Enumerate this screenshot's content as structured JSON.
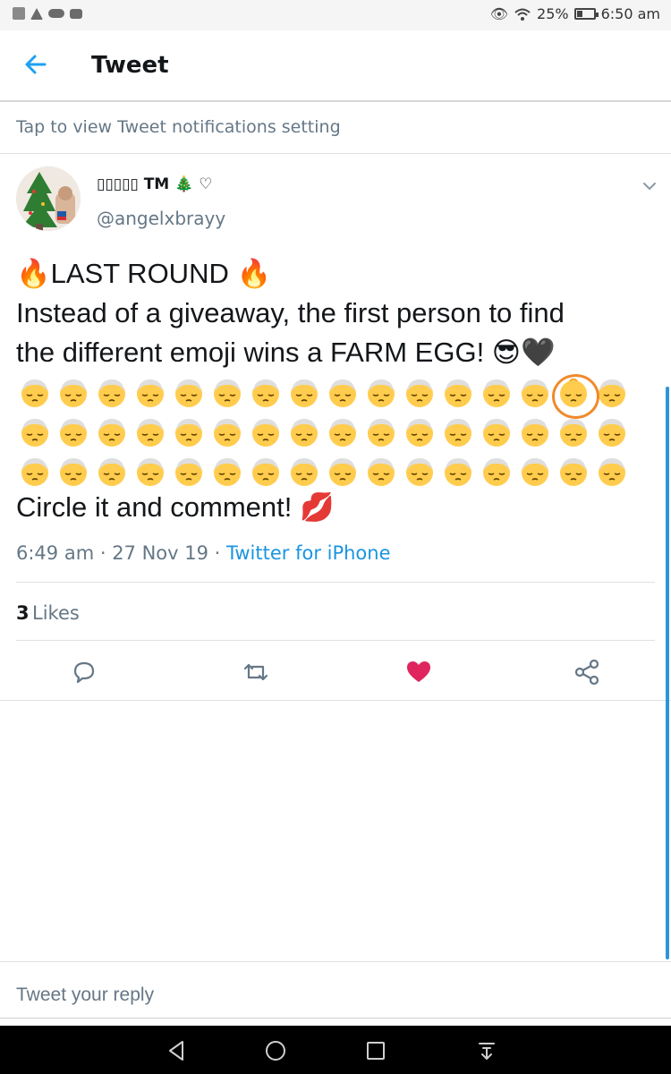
{
  "status_bar": {
    "battery_pct": "25%",
    "time": "6:50 am"
  },
  "header": {
    "back_icon": "arrow-left-icon",
    "title": "Tweet"
  },
  "notice": {
    "text": "Tap to view Tweet notifications setting"
  },
  "tweet": {
    "display_name": "▯▯▯▯▯ TM 🎄 ♡",
    "handle": "@angelxbrayy",
    "text_lines": [
      "🔥LAST ROUND 🔥",
      "Instead of a giveaway, the first person to find",
      "the different emoji wins a FARM EGG! 😎🖤"
    ],
    "emoji_rows": 3,
    "emoji_cols": 16,
    "different_emoji_position": {
      "row": 1,
      "col": 15
    },
    "closing_line": "Circle it and comment! 💋",
    "time": "6:49 am",
    "date": "27 Nov 19",
    "source": "Twitter for iPhone",
    "separator": " · ",
    "likes_count": "3",
    "likes_label": "Likes"
  },
  "actions": {
    "reply_icon": "reply-icon",
    "retweet_icon": "retweet-icon",
    "like_icon": "heart-icon",
    "share_icon": "share-icon",
    "like_color": "#e0245e"
  },
  "reply": {
    "placeholder": "Tweet your reply"
  },
  "colors": {
    "accent": "#1da1f2",
    "link": "#1b95e0",
    "secondary_text": "#657786",
    "circle_highlight": "#f08a2c"
  }
}
